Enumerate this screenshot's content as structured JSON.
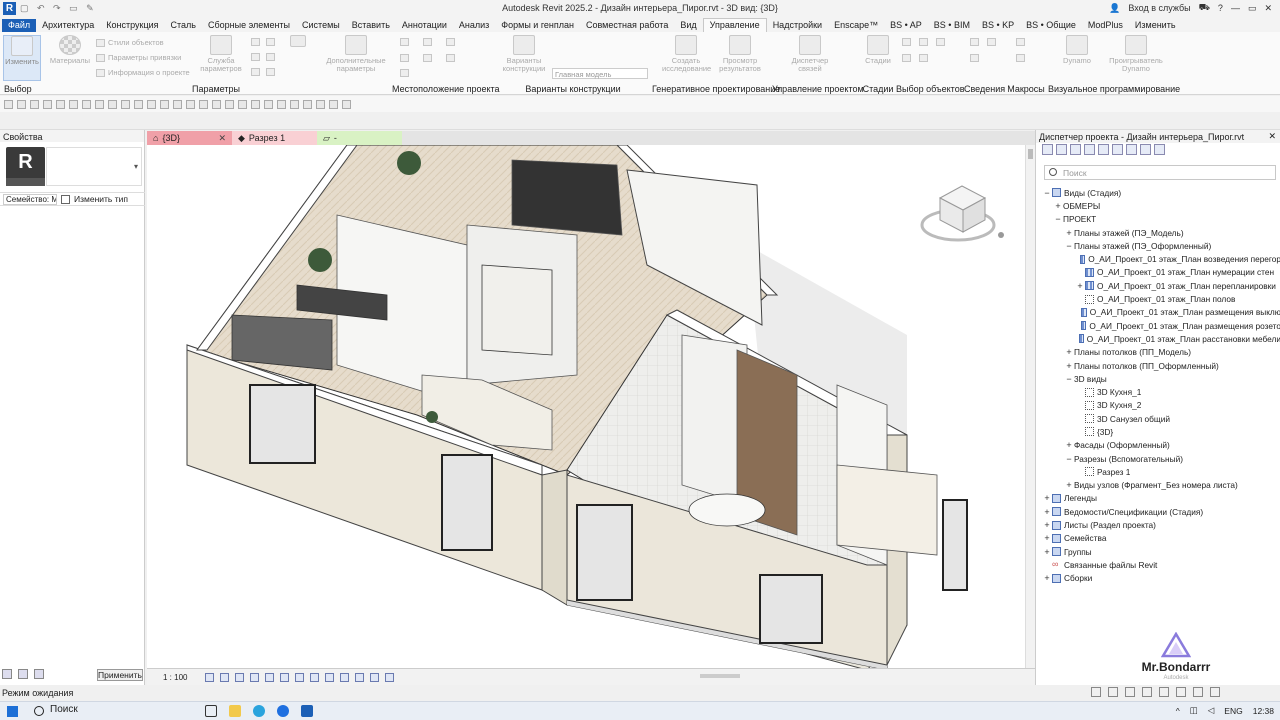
{
  "titlebar": {
    "title": "Autodesk Revit 2025.2 - Дизайн интерьера_Пирог.rvt - 3D вид: {3D}",
    "sign_in": "Вход в службы",
    "help": "?"
  },
  "tabs": [
    "Файл",
    "Архитектура",
    "Конструкция",
    "Сталь",
    "Сборные элементы",
    "Системы",
    "Вставить",
    "Аннотации",
    "Анализ",
    "Формы и генплан",
    "Совместная работа",
    "Вид",
    "Управление",
    "Надстройки",
    "Enscape™",
    "BS • AP",
    "BS • BIM",
    "BS • KP",
    "BS • Общие",
    "ModPlus",
    "Изменить"
  ],
  "active_tab": "Управление",
  "ribbon": {
    "modify": "Изменить",
    "materials": "Материалы",
    "object_styles": "Стили объектов",
    "snaps": "Параметры привязки",
    "project_info": "Информация о проекте",
    "project_params_service": "Служба параметров",
    "additional_params": "Дополнительные параметры",
    "variants_construct": "Варианты конструкции",
    "main_model": "Главная модель",
    "create_study": "Создать исследование",
    "view_results": "Просмотр результатов",
    "links_manager": "Диспетчер связей",
    "stages": "Стадии",
    "dynamo": "Dynamo",
    "dynamo_player": "Проигрыватель Dynamo",
    "panels": [
      "Выбор",
      "Параметры",
      "Местоположение проекта",
      "Варианты конструкции",
      "Генеративное проектирование",
      "Управление проектом",
      "Стадии",
      "Выбор объектов",
      "Сведения",
      "Макросы",
      "Визуальное программирование"
    ]
  },
  "properties": {
    "header": "Свойства",
    "family_label": "Семейство: Ма",
    "edit_type": "Изменить тип",
    "apply": "Применить"
  },
  "view_tabs": [
    {
      "label": "{3D}"
    },
    {
      "label": "Разрез 1"
    },
    {
      "label": "-"
    }
  ],
  "viewbar": {
    "scale": "1 : 100"
  },
  "project_browser": {
    "header": "Диспетчер проекта - Дизайн интерьера_Пирог.rvt",
    "search_placeholder": "Поиск",
    "tree": [
      {
        "label": "Виды (Стадия)",
        "level": 0,
        "exp": "−",
        "icon": "views"
      },
      {
        "label": "ОБМЕРЫ",
        "level": 1,
        "exp": "+",
        "icon": ""
      },
      {
        "label": "ПРОЕКТ",
        "level": 1,
        "exp": "−",
        "icon": ""
      },
      {
        "label": "Планы этажей (ПЭ_Модель)",
        "level": 2,
        "exp": "+",
        "icon": ""
      },
      {
        "label": "Планы этажей (ПЭ_Оформленный)",
        "level": 2,
        "exp": "−",
        "icon": ""
      },
      {
        "label": "О_АИ_Проект_01 этаж_План возведения перегор",
        "level": 3,
        "exp": "",
        "icon": "view"
      },
      {
        "label": "О_АИ_Проект_01 этаж_План нумерации стен",
        "level": 3,
        "exp": "",
        "icon": "view"
      },
      {
        "label": "О_АИ_Проект_01 этаж_План перепланировки",
        "level": 3,
        "exp": "+",
        "icon": "view"
      },
      {
        "label": "О_АИ_Проект_01 этаж_План полов",
        "level": 3,
        "exp": "",
        "icon": "plain"
      },
      {
        "label": "О_АИ_Проект_01 этаж_План размещения выклю",
        "level": 3,
        "exp": "",
        "icon": "view"
      },
      {
        "label": "О_АИ_Проект_01 этаж_План размещения розето",
        "level": 3,
        "exp": "",
        "icon": "view"
      },
      {
        "label": "О_АИ_Проект_01 этаж_План расстановки мебели",
        "level": 3,
        "exp": "",
        "icon": "view"
      },
      {
        "label": "Планы потолков (ПП_Модель)",
        "level": 2,
        "exp": "+",
        "icon": ""
      },
      {
        "label": "Планы потолков (ПП_Оформленный)",
        "level": 2,
        "exp": "+",
        "icon": ""
      },
      {
        "label": "3D виды",
        "level": 2,
        "exp": "−",
        "icon": ""
      },
      {
        "label": "3D Кухня_1",
        "level": 3,
        "exp": "",
        "icon": "plain"
      },
      {
        "label": "3D Кухня_2",
        "level": 3,
        "exp": "",
        "icon": "plain"
      },
      {
        "label": "3D Санузел общий",
        "level": 3,
        "exp": "",
        "icon": "plain"
      },
      {
        "label": "{3D}",
        "level": 3,
        "exp": "",
        "icon": "plain"
      },
      {
        "label": "Фасады (Оформленный)",
        "level": 2,
        "exp": "+",
        "icon": ""
      },
      {
        "label": "Разрезы (Вспомогательный)",
        "level": 2,
        "exp": "−",
        "icon": ""
      },
      {
        "label": "Разрез 1",
        "level": 3,
        "exp": "",
        "icon": "plain"
      },
      {
        "label": "Виды узлов (Фрагмент_Без номера листа)",
        "level": 2,
        "exp": "+",
        "icon": ""
      },
      {
        "label": "Легенды",
        "level": 0,
        "exp": "+",
        "icon": "views"
      },
      {
        "label": "Ведомости/Спецификации (Стадия)",
        "level": 0,
        "exp": "+",
        "icon": "views"
      },
      {
        "label": "Листы (Раздел проекта)",
        "level": 0,
        "exp": "+",
        "icon": "views"
      },
      {
        "label": "Семейства",
        "level": 0,
        "exp": "+",
        "icon": "views"
      },
      {
        "label": "Группы",
        "level": 0,
        "exp": "+",
        "icon": "views"
      },
      {
        "label": "Связанные файлы Revit",
        "level": 0,
        "exp": "",
        "icon": "link"
      },
      {
        "label": "Сборки",
        "level": 0,
        "exp": "+",
        "icon": "views"
      }
    ]
  },
  "status": {
    "text": "Режим ожидания"
  },
  "taskbar": {
    "search": "Поиск",
    "lang": "ENG",
    "time": "12:38"
  },
  "watermark": {
    "name": "Mr.Bondarrr",
    "sub": "Autodesk"
  },
  "colors": {
    "file_tab": "#1b5fb6",
    "view_tab_active": "#f0a0a8"
  }
}
